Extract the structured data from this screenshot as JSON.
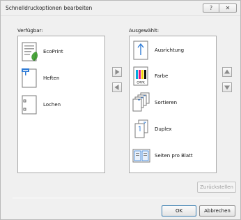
{
  "window": {
    "title": "Schnelldruckoptionen bearbeiten",
    "help_glyph": "?",
    "close_glyph": "✕"
  },
  "available": {
    "label": "Verfügbar:",
    "items": [
      {
        "label": "EcoPrint",
        "icon": "ecoprint-icon"
      },
      {
        "label": "Heften",
        "icon": "staple-icon"
      },
      {
        "label": "Lochen",
        "icon": "punch-icon"
      }
    ]
  },
  "selected": {
    "label": "Ausgewählt:",
    "items": [
      {
        "label": "Ausrichtung",
        "icon": "orientation-icon"
      },
      {
        "label": "Farbe",
        "icon": "color-icon"
      },
      {
        "label": "Sortieren",
        "icon": "collate-icon"
      },
      {
        "label": "Duplex",
        "icon": "duplex-icon"
      },
      {
        "label": "Seiten pro Blatt",
        "icon": "pages-per-sheet-icon"
      }
    ]
  },
  "color_icon_text": "CMYK",
  "buttons": {
    "reset": "Zurückstellen",
    "ok": "OK",
    "cancel": "Abbrechen"
  }
}
